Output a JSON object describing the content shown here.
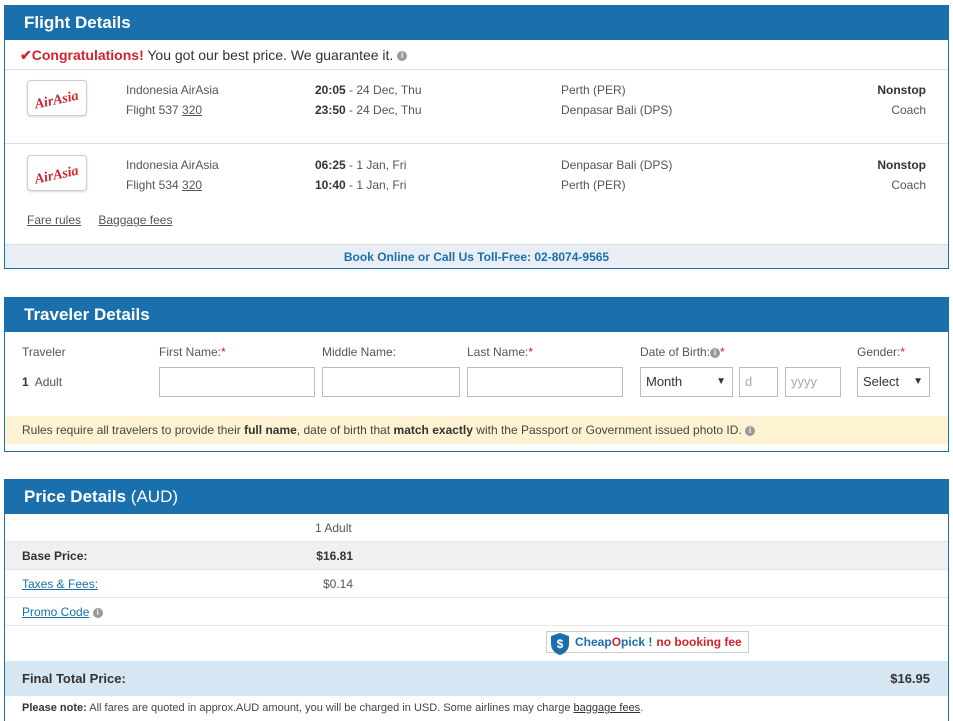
{
  "flight": {
    "title": "Flight Details",
    "congrats_check": "✔",
    "congrats_strong": "Congratulations!",
    "congrats_text": "You got our best price. We guarantee it.",
    "segments": [
      {
        "airline": "Indonesia AirAsia",
        "flight_prefix": "Flight 537",
        "aircraft": "320",
        "dep_time": "20:05",
        "dep_date": "- 24 Dec, Thu",
        "arr_time": "23:50",
        "arr_date": "- 24 Dec, Thu",
        "from": "Perth (PER)",
        "to": "Denpasar Bali (DPS)",
        "stops": "Nonstop",
        "cabin": "Coach"
      },
      {
        "airline": "Indonesia AirAsia",
        "flight_prefix": "Flight 534",
        "aircraft": "320",
        "dep_time": "06:25",
        "dep_date": "- 1 Jan, Fri",
        "arr_time": "10:40",
        "arr_date": "- 1 Jan, Fri",
        "from": "Denpasar Bali (DPS)",
        "to": "Perth (PER)",
        "stops": "Nonstop",
        "cabin": "Coach"
      }
    ],
    "logo_text": "AirAsia",
    "fare_rules": "Fare rules",
    "baggage_fees": "Baggage fees",
    "book_bar": "Book Online or Call Us Toll-Free: 02-8074-9565"
  },
  "traveler": {
    "title": "Traveler Details",
    "col_traveler": "Traveler",
    "col_first": "First Name:",
    "col_middle": "Middle Name:",
    "col_last": "Last Name:",
    "col_dob": "Date of Birth:",
    "col_gender": "Gender:",
    "required_mark": "*",
    "traveler_num": "1",
    "traveler_type": "Adult",
    "month_value": "Month",
    "day_placeholder": "d",
    "year_placeholder": "yyyy",
    "gender_value": "Select",
    "rules_prefix": "Rules require all travelers to provide their",
    "rules_full_name": "full name",
    "rules_mid": ", date of birth that",
    "rules_match": "match exactly",
    "rules_suffix": "with the Passport or Government issued photo ID."
  },
  "price": {
    "title": "Price Details",
    "currency": "(AUD)",
    "pax_header": "1 Adult",
    "base_label": "Base Price:",
    "base_value": "$16.81",
    "taxes_label": "Taxes & Fees:",
    "taxes_value": "$0.14",
    "promo_label": "Promo Code",
    "badge_cheap": "Cheap",
    "badge_o": "O",
    "badge_pick": "pick !",
    "badge_nofee": "no booking fee",
    "final_label": "Final Total Price:",
    "final_value": "$16.95",
    "note_label": "Please note:",
    "note_text": "All fares are quoted in approx.AUD amount, you will be charged in USD. Some airlines may charge",
    "note_link": "baggage fees",
    "note_end": "."
  },
  "colors": {
    "header_blue": "#1a6fad",
    "accent_red": "#d2232a",
    "rules_bg": "#fdf3d3",
    "final_bg": "#d6e6f2"
  }
}
